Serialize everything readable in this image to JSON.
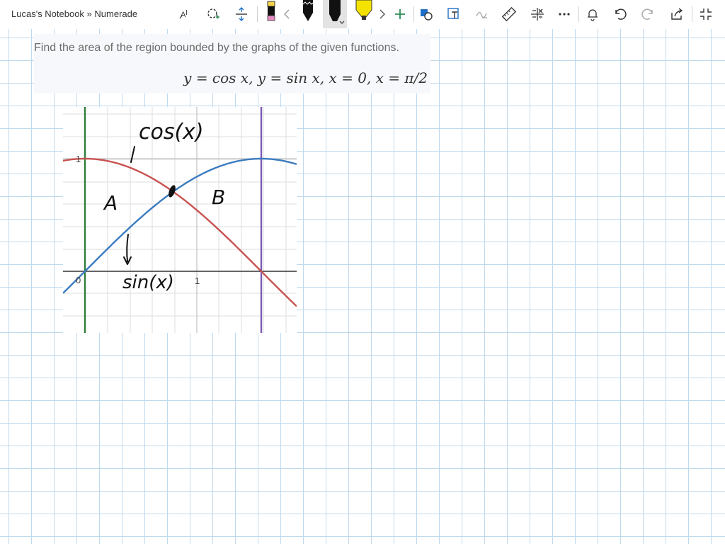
{
  "header": {
    "title": "Lucas's Notebook » Numerade"
  },
  "toolbar": {
    "tools": [
      "text-select-icon",
      "lasso-select-icon",
      "add-space-icon",
      "eraser-icon",
      "scroll-left-icon",
      "black-pen-icon",
      "black-marker-icon",
      "yellow-highlighter-icon",
      "scroll-right-icon",
      "add-pen-icon",
      "shapes-icon",
      "ink-to-text-icon",
      "ink-to-math-icon",
      "ruler-icon",
      "math-icon",
      "more-icon",
      "replay-icon",
      "undo-icon",
      "redo-icon",
      "share-icon",
      "fullscreen-icon"
    ],
    "selected_pen": "black-marker-icon"
  },
  "problem": {
    "text": "Find the area of the region bounded by the graphs of the given functions.",
    "equation": "y = cos x, y = sin x, x = 0, x = π/2"
  },
  "graph": {
    "tick_label_0": "0",
    "tick_label_x1": "1",
    "tick_label_y1": "1",
    "ink_label_cos": "cos(x)",
    "ink_label_sin": "sin(x)",
    "ink_label_A": "A",
    "ink_label_B": "B",
    "colors": {
      "cos": "#c85250",
      "sin": "#3b7bbf",
      "x0_line": "#2e7d3a",
      "x_pi2_line": "#7b5ab5"
    }
  }
}
